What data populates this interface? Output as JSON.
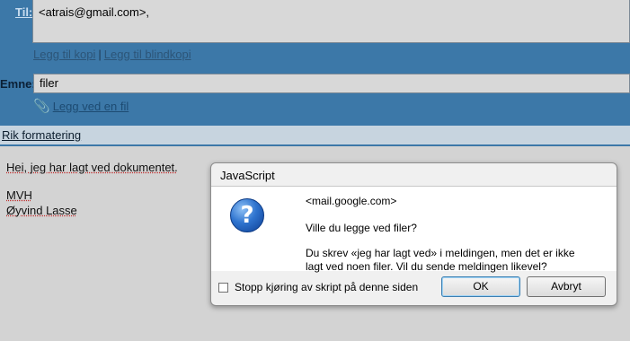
{
  "compose": {
    "to_label": "Til:",
    "to_value": "<atrais@gmail.com>,",
    "add_cc": "Legg til kopi",
    "separator": "|",
    "add_bcc": "Legg til blindkopi",
    "subject_label": "Emne:",
    "subject_value": "filer",
    "attach_link": "Legg ved en fil",
    "attach_icon": "paperclip-icon"
  },
  "format_bar": {
    "rich_formatting": "Rik formatering"
  },
  "body": {
    "line1": "Hei, jeg har lagt ved dokumentet.",
    "line2": "MVH",
    "line3": "Øyvind Lasse"
  },
  "dialog": {
    "title": "JavaScript",
    "origin": "<mail.google.com>",
    "question": "Ville du legge ved filer?",
    "message_line1": "Du skrev «jeg har lagt ved» i meldingen, men det er ikke",
    "message_line2": "lagt ved noen filer.  Vil du sende meldingen likevel?",
    "icon": "question-icon",
    "checkbox_label": "Stopp kjøring av skript på denne siden",
    "ok_label": "OK",
    "cancel_label": "Avbryt"
  }
}
